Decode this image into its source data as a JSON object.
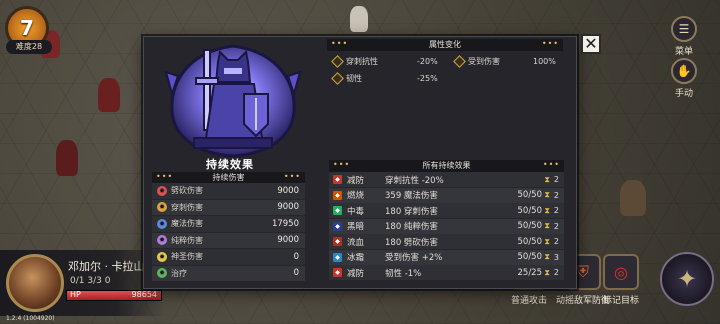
{
  "hud": {
    "level": "7",
    "difficulty": "难度28",
    "menu_label": "菜单",
    "manual_label": "手动",
    "hero_name": "邓加尔 · 卡拉山",
    "hero_counts": "0/1   3/3   0",
    "hp_label": "HP",
    "hp_value": "98654",
    "hp_fraction": 1.0,
    "version": "1.2.4 (1004920)",
    "skills": [
      {
        "label": "普通攻击",
        "icon": "sword-icon"
      },
      {
        "label": "动摇敌军防御",
        "icon": "shield-break-icon"
      },
      {
        "label": "标记目标",
        "icon": "target-icon"
      }
    ]
  },
  "modal": {
    "emblem_title": "持续效果",
    "attr_section": {
      "title": "属性变化",
      "items": [
        {
          "icon": "pierce-resist-icon",
          "label": "穿刺抗性",
          "value": "-20%"
        },
        {
          "icon": "damage-taken-icon",
          "label": "受到伤害",
          "value": "100%"
        },
        {
          "icon": "toughness-icon",
          "label": "韧性",
          "value": "-25%"
        }
      ]
    },
    "left_section": {
      "title": "持续伤害",
      "rows": [
        {
          "label": "劈砍伤害",
          "value": "9000",
          "color": "#d9534f",
          "icon": "slash-damage-icon"
        },
        {
          "label": "穿刺伤害",
          "value": "9000",
          "color": "#d9a441",
          "icon": "pierce-damage-icon"
        },
        {
          "label": "魔法伤害",
          "value": "17950",
          "color": "#5b8bd9",
          "icon": "magic-damage-icon"
        },
        {
          "label": "纯粹伤害",
          "value": "9000",
          "color": "#b07bd9",
          "icon": "pure-damage-icon"
        },
        {
          "label": "神圣伤害",
          "value": "0",
          "color": "#e8c84a",
          "icon": "holy-damage-icon"
        },
        {
          "label": "治疗",
          "value": "0",
          "color": "#5fb65f",
          "icon": "heal-icon"
        }
      ]
    },
    "right_section": {
      "title": "所有持续效果",
      "rows": [
        {
          "name": "减防",
          "desc": "穿刺抗性 -20%",
          "count": "",
          "stack": "2",
          "color": "#c0392b"
        },
        {
          "name": "燃烧",
          "desc": "359 魔法伤害",
          "count": "50/50",
          "stack": "2",
          "color": "#d35400"
        },
        {
          "name": "中毒",
          "desc": "180 穿刺伤害",
          "count": "50/50",
          "stack": "2",
          "color": "#27ae60"
        },
        {
          "name": "黑暗",
          "desc": "180 纯粹伤害",
          "count": "50/50",
          "stack": "2",
          "color": "#2c3e90"
        },
        {
          "name": "流血",
          "desc": "180 劈砍伤害",
          "count": "50/50",
          "stack": "2",
          "color": "#a93226"
        },
        {
          "name": "冰霜",
          "desc": "受到伤害 +2%",
          "count": "50/50",
          "stack": "3",
          "color": "#2e86c1"
        },
        {
          "name": "减防",
          "desc": "韧性 -1%",
          "count": "25/25",
          "stack": "2",
          "color": "#c0392b"
        }
      ]
    }
  }
}
